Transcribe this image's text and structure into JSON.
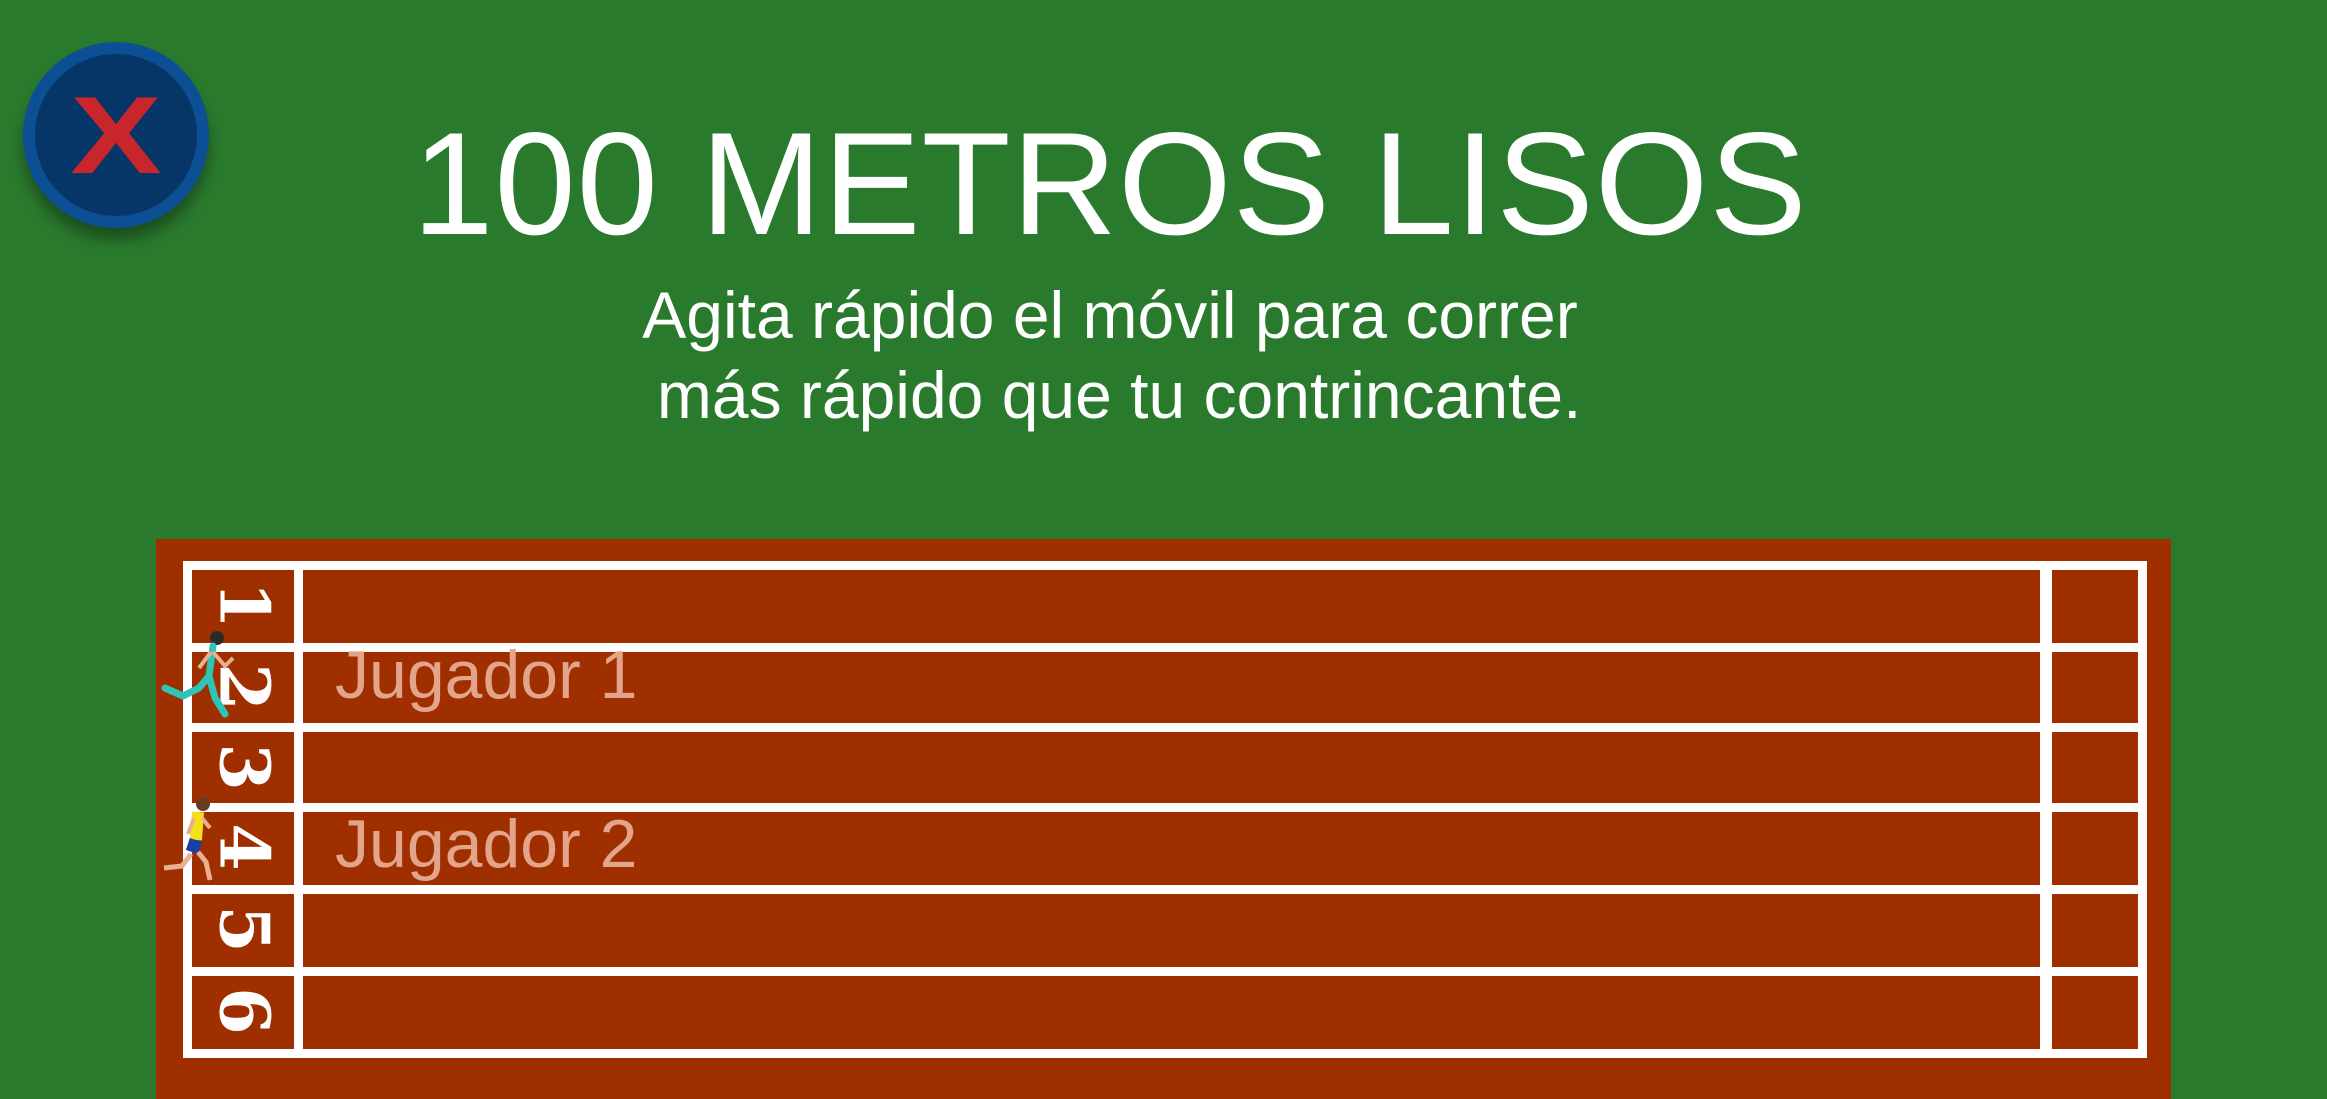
{
  "close_button": {
    "icon": "close-x-icon",
    "label": "X",
    "colors": {
      "ring": "#0d4f94",
      "fill": "#063567",
      "x": "#c8262a"
    }
  },
  "title": "100 METROS LISOS",
  "subtitle": {
    "line1": "Agita rápido el móvil para correr",
    "line2": " más rápido que tu contrincante."
  },
  "track": {
    "lane_numbers": [
      "1",
      "2",
      "3",
      "4",
      "5",
      "6"
    ],
    "players": [
      {
        "label": "Jugador 1",
        "lane": 2,
        "runner": "runner-teal-icon"
      },
      {
        "label": "Jugador 2",
        "lane": 4,
        "runner": "runner-yellow-icon"
      }
    ],
    "colors": {
      "track": "#a02f00",
      "grass": "#2a7a2e",
      "lines": "#ffffff",
      "player_label": "#e3a48c"
    }
  }
}
